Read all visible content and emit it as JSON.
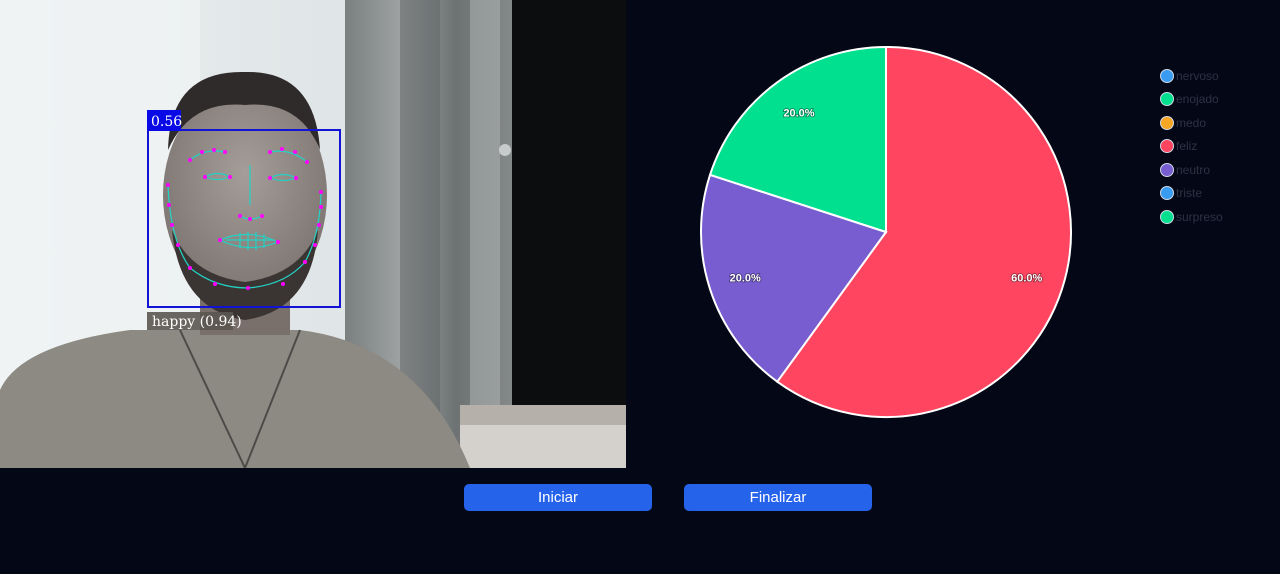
{
  "detection": {
    "score_label": "0.56",
    "expression_label": "happy (0.94)",
    "box_color": "#1313d6",
    "landmark_color": "#ff00ff",
    "contour_color": "#22d3c5"
  },
  "legend": {
    "items": [
      {
        "label": "nervoso",
        "color": "#3a9cf0"
      },
      {
        "label": "enojado",
        "color": "#00e08f"
      },
      {
        "label": "medo",
        "color": "#f6a623"
      },
      {
        "label": "feliz",
        "color": "#ff4560"
      },
      {
        "label": "neutro",
        "color": "#775dd0"
      },
      {
        "label": "triste",
        "color": "#3a9cf0"
      },
      {
        "label": "surpreso",
        "color": "#00e08f"
      }
    ]
  },
  "chart_data": {
    "type": "pie",
    "title": "",
    "slices": [
      {
        "label": "feliz",
        "value": 60.0,
        "display": "60.0%",
        "color": "#ff4560"
      },
      {
        "label": "neutro",
        "value": 20.0,
        "display": "20.0%",
        "color": "#775dd0"
      },
      {
        "label": "surpreso",
        "value": 20.0,
        "display": "20.0%",
        "color": "#00e08f"
      }
    ],
    "legend_position": "right"
  },
  "controls": {
    "start_label": "Iniciar",
    "stop_label": "Finalizar"
  }
}
